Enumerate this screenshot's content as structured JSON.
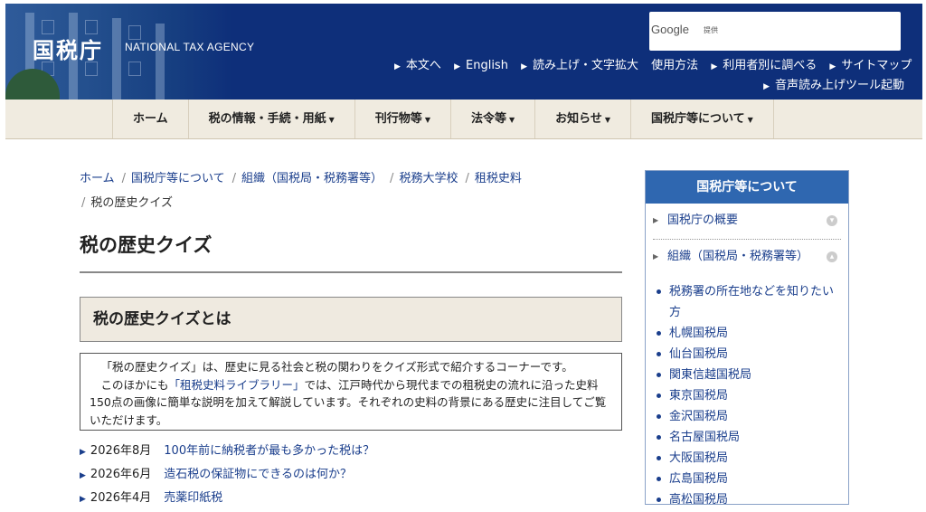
{
  "header": {
    "logo": "国税庁",
    "agency_en": "NATIONAL TAX AGENCY",
    "search": {
      "brand": "Google",
      "provider": "提供"
    },
    "links_row1": [
      "本文へ",
      "English",
      "読み上げ・文字拡大",
      "使用方法",
      "利用者別に調べる",
      "サイトマップ"
    ],
    "links_row2": [
      "音声読み上げツール起動"
    ]
  },
  "nav": [
    "ホーム",
    "税の情報・手続・用紙",
    "刊行物等",
    "法令等",
    "お知らせ",
    "国税庁等について"
  ],
  "breadcrumb": {
    "links": [
      "ホーム",
      "国税庁等について",
      "組織（国税局・税務署等）",
      "税務大学校",
      "租税史料"
    ],
    "current": "税の歴史クイズ"
  },
  "page_title": "税の歴史クイズ",
  "section_title": "税の歴史クイズとは",
  "intro": {
    "p1": "「税の歴史クイズ」は、歴史に見る社会と税の関わりをクイズ形式で紹介するコーナーです。",
    "p2_before": "このほかにも",
    "p2_link": "「租税史料ライブラリー」",
    "p2_after": "では、江戸時代から現代までの租税史の流れに沿った史料150点の画像に簡単な説明を加えて解説しています。それぞれの史料の背景にある歴史に注目してご覧いただけます。"
  },
  "news": [
    {
      "date": "2026年8月",
      "title": "100年前に納税者が最も多かった税は？"
    },
    {
      "date": "2026年6月",
      "title": "造石税の保証物にできるのは何か？"
    },
    {
      "date": "2026年4月",
      "title": "売薬印紙税"
    }
  ],
  "sidebar": {
    "title": "国税庁等について",
    "cat1": "国税庁の概要",
    "cat2": "組織（国税局・税務署等）",
    "items": [
      "税務署の所在地などを知りたい方",
      "札幌国税局",
      "仙台国税局",
      "関東信越国税局",
      "東京国税局",
      "金沢国税局",
      "名古屋国税局",
      "大阪国税局",
      "広島国税局",
      "高松国税局"
    ]
  }
}
